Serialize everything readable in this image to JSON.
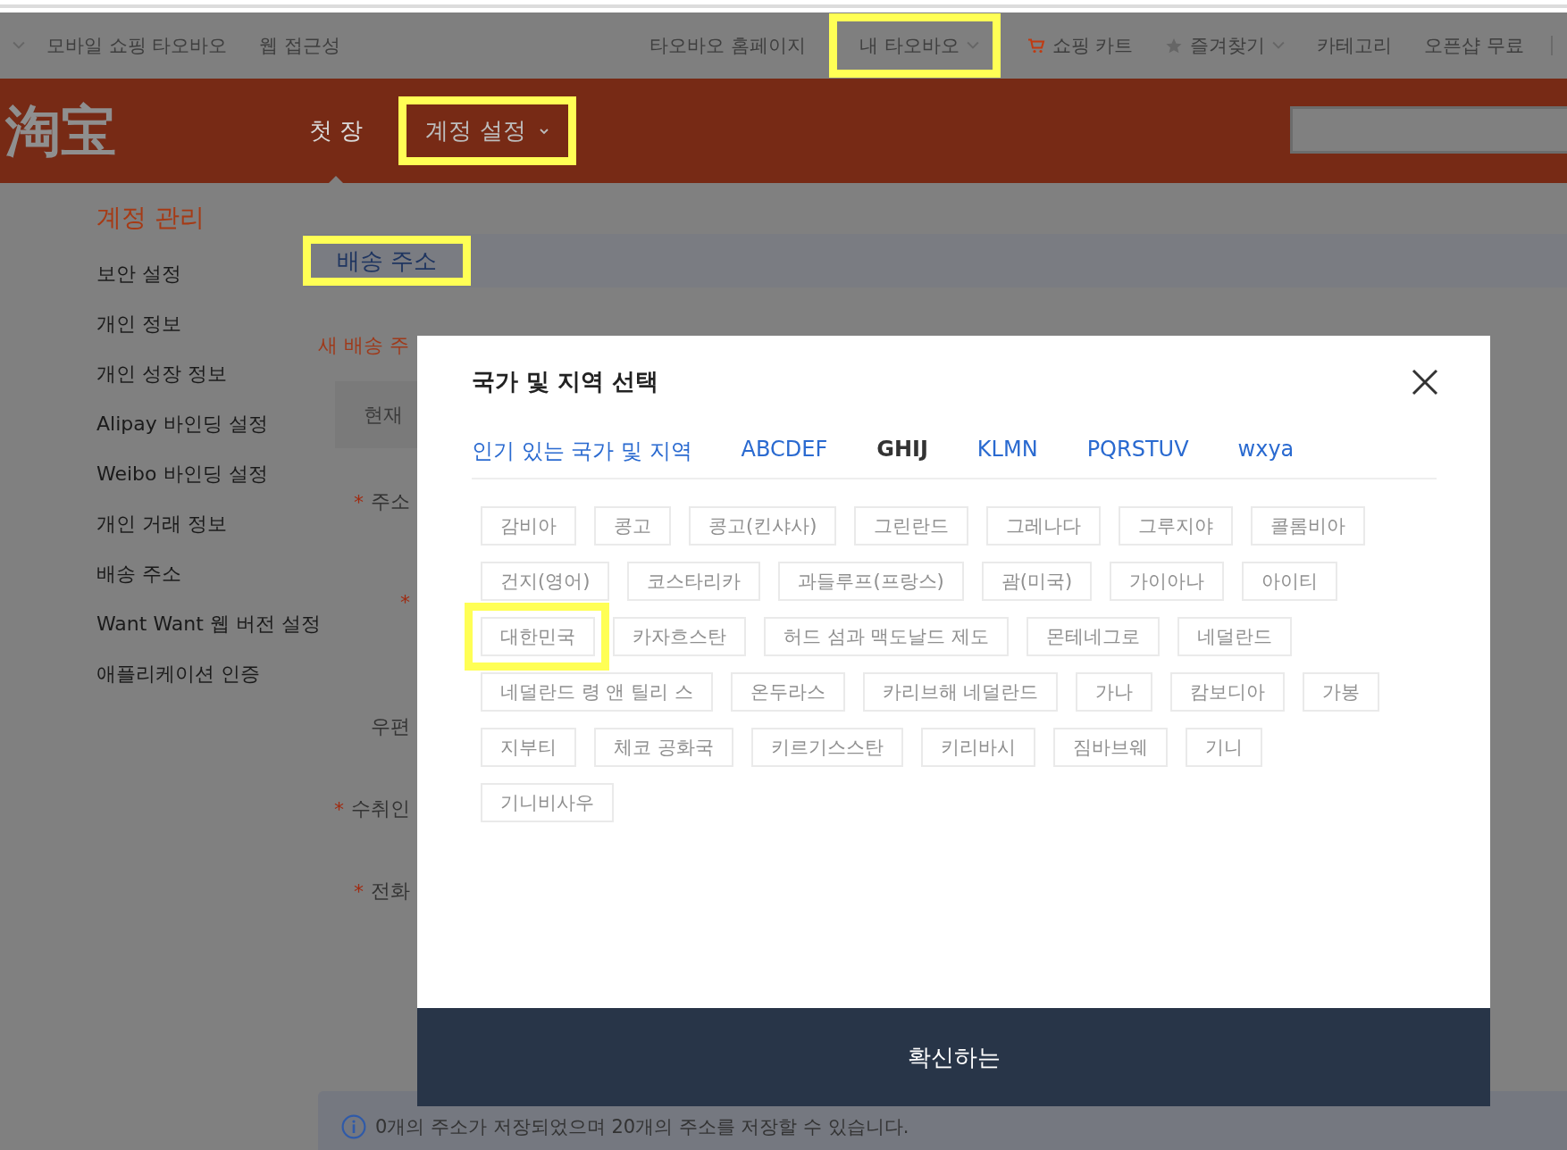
{
  "topbar": {
    "left": [
      {
        "label": "모바일 쇼핑 타오바오"
      },
      {
        "label": "웹 접근성"
      }
    ],
    "right": [
      {
        "label": "타오바오 홈페이지",
        "kind": "link",
        "highlighted": false
      },
      {
        "label": "내 타오바오",
        "kind": "dropdown",
        "highlighted": true
      },
      {
        "label": "쇼핑 카트",
        "kind": "cart",
        "highlighted": false
      },
      {
        "label": "즐겨찾기",
        "kind": "favorites",
        "highlighted": false
      },
      {
        "label": "카테고리",
        "kind": "link",
        "highlighted": false
      },
      {
        "label": "오픈샵 무료",
        "kind": "link",
        "highlighted": false
      }
    ]
  },
  "header": {
    "logo": "淘宝",
    "nav": [
      {
        "label": "첫 장",
        "kind": "link",
        "selected": true,
        "highlighted": false
      },
      {
        "label": "계정 설정",
        "kind": "dropdown",
        "selected": false,
        "highlighted": true
      }
    ]
  },
  "sidebar": {
    "title": "계정 관리",
    "items": [
      "보안 설정",
      "개인 정보",
      "개인 성장 정보",
      "Alipay 바인딩 설정",
      "Weibo 바인딩 설정",
      "개인 거래 정보",
      "배송 주소",
      "Want Want 웹 버전 설정",
      "애플리케이션 인증"
    ]
  },
  "section": {
    "title": "배송 주소",
    "highlighted": true
  },
  "form": {
    "heading": "새 배송 주",
    "field_value": "현재",
    "rows": [
      {
        "mark": "*",
        "label": "주소"
      },
      {
        "mark": "*"
      },
      {
        "label": "우편"
      },
      {
        "mark": "*",
        "label": "수취인"
      },
      {
        "mark": "*",
        "label": "전화"
      }
    ]
  },
  "info": "0개의 주소가 저장되었으며 20개의 주소를 저장할 수 있습니다.",
  "modal": {
    "title": "국가 및 지역 선택",
    "tabs": [
      {
        "label": "인기 있는 국가 및 지역",
        "selected": false
      },
      {
        "label": "ABCDEF",
        "selected": false
      },
      {
        "label": "GHIJ",
        "selected": true
      },
      {
        "label": "KLMN",
        "selected": false
      },
      {
        "label": "PQRSTUV",
        "selected": false
      },
      {
        "label": "wxya",
        "selected": false
      }
    ],
    "chip_rows": [
      [
        {
          "label": "감비아",
          "highlighted": false
        },
        {
          "label": "콩고",
          "highlighted": false
        },
        {
          "label": "콩고(킨샤사)",
          "highlighted": false
        },
        {
          "label": "그린란드",
          "highlighted": false
        },
        {
          "label": "그레나다",
          "highlighted": false
        },
        {
          "label": "그루지야",
          "highlighted": false
        },
        {
          "label": "콜롬비아",
          "highlighted": false
        }
      ],
      [
        {
          "label": "건지(영어)",
          "highlighted": false
        },
        {
          "label": "코스타리카",
          "highlighted": false
        },
        {
          "label": "과들루프(프랑스)",
          "highlighted": false
        },
        {
          "label": "괌(미국)",
          "highlighted": false
        },
        {
          "label": "가이아나",
          "highlighted": false
        },
        {
          "label": "아이티",
          "highlighted": false
        }
      ],
      [
        {
          "label": "대한민국",
          "highlighted": true
        },
        {
          "label": "카자흐스탄",
          "highlighted": false
        },
        {
          "label": "허드 섬과 맥도날드 제도",
          "highlighted": false
        },
        {
          "label": "몬테네그로",
          "highlighted": false
        },
        {
          "label": "네덜란드",
          "highlighted": false
        }
      ],
      [
        {
          "label": "네덜란드 령 앤 틸리 스",
          "highlighted": false
        },
        {
          "label": "온두라스",
          "highlighted": false
        },
        {
          "label": "카리브해 네덜란드",
          "highlighted": false
        },
        {
          "label": "가나",
          "highlighted": false
        },
        {
          "label": "캄보디아",
          "highlighted": false
        },
        {
          "label": "가봉",
          "highlighted": false
        }
      ],
      [
        {
          "label": "지부티",
          "highlighted": false
        },
        {
          "label": "체코 공화국",
          "highlighted": false
        },
        {
          "label": "키르기스스탄",
          "highlighted": false
        },
        {
          "label": "키리바시",
          "highlighted": false
        },
        {
          "label": "짐바브웨",
          "highlighted": false
        },
        {
          "label": "기니",
          "highlighted": false
        }
      ],
      [
        {
          "label": "기니비사우",
          "highlighted": false
        }
      ]
    ],
    "confirm": "확신하는"
  }
}
